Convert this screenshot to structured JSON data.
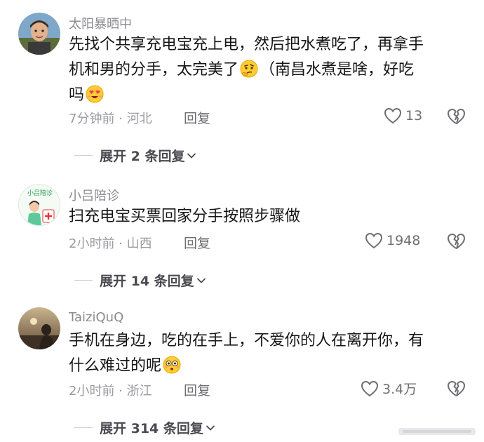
{
  "comments": [
    {
      "username": "太阳暴晒中",
      "lines": [
        "先找个共享充电宝充上电，然后把水煮吃了，再拿手",
        "机和男的分手，太完美了",
        "（南昌水煮是啥，好吃",
        "吗"
      ],
      "meta": "7分钟前 · 河北",
      "reply": "回复",
      "likes": "13",
      "expand": "展开 2 条回复"
    },
    {
      "username": "小吕陪诊",
      "avatar_text": "小吕陪诊",
      "lines": [
        "扫充电宝买票回家分手按照步骤做"
      ],
      "meta": "2小时前 · 山西",
      "reply": "回复",
      "likes": "1948",
      "expand": "展开 14 条回复"
    },
    {
      "username": "TaiziQuQ",
      "lines": [
        "手机在身边，吃的在手上，不爱你的人在离开你，有",
        "什么难过的呢"
      ],
      "meta": "2小时前 · 浙江",
      "reply": "回复",
      "likes": "3.4万",
      "expand": "展开 314 条回复"
    }
  ],
  "icons": {
    "like": "heart-outline-icon",
    "dislike": "broken-heart-icon",
    "expand": "chevron-down-icon"
  },
  "colors": {
    "text": "#161616",
    "secondary": "#8b8b90",
    "action": "#6e6e74"
  }
}
